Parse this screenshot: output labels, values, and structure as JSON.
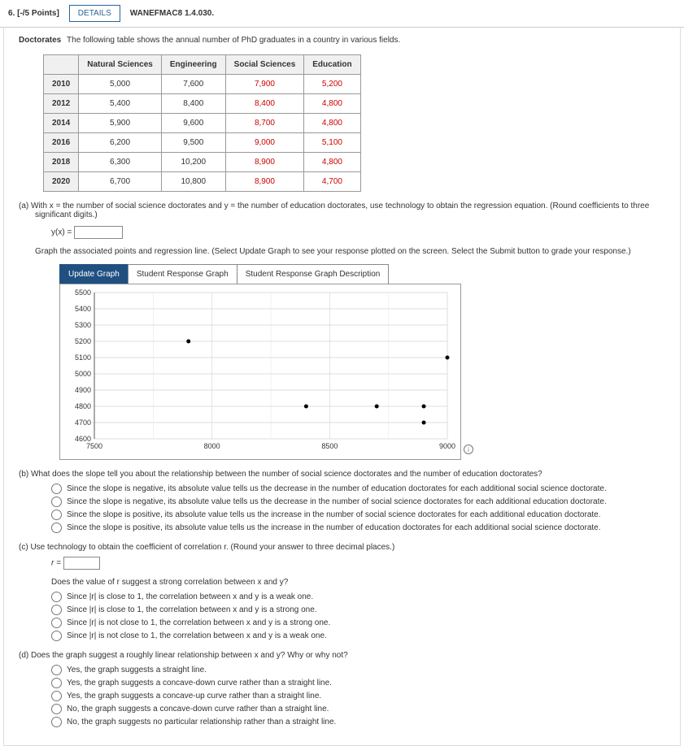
{
  "header": {
    "qnum": "6. [-/5 Points]",
    "details": "DETAILS",
    "book": "WANEFMAC8 1.4.030."
  },
  "intro": {
    "title": "Doctorates",
    "desc": "The following table shows the annual number of PhD graduates in a country in various fields."
  },
  "table": {
    "headers": [
      "",
      "Natural Sciences",
      "Engineering",
      "Social Sciences",
      "Education"
    ],
    "rows": [
      {
        "year": "2010",
        "cells": [
          "5,000",
          "7,600",
          "7,900",
          "5,200"
        ]
      },
      {
        "year": "2012",
        "cells": [
          "5,400",
          "8,400",
          "8,400",
          "4,800"
        ]
      },
      {
        "year": "2014",
        "cells": [
          "5,900",
          "9,600",
          "8,700",
          "4,800"
        ]
      },
      {
        "year": "2016",
        "cells": [
          "6,200",
          "9,500",
          "9,000",
          "5,100"
        ]
      },
      {
        "year": "2018",
        "cells": [
          "6,300",
          "10,200",
          "8,900",
          "4,800"
        ]
      },
      {
        "year": "2020",
        "cells": [
          "6,700",
          "10,800",
          "8,900",
          "4,700"
        ]
      }
    ]
  },
  "part_a": {
    "label": "(a)",
    "text": "With x = the number of social science doctorates and y = the number of education doctorates, use technology to obtain the regression equation. (Round coefficients to three significant digits.)",
    "yx": "y(x) = ",
    "graph_instr": "Graph the associated points and regression line. (Select Update Graph to see your response plotted on the screen. Select the Submit button to grade your response.)",
    "tabs": {
      "update": "Update Graph",
      "resp": "Student Response Graph",
      "desc": "Student Response Graph Description"
    }
  },
  "chart_data": {
    "type": "scatter",
    "x": [
      7900,
      8400,
      8700,
      9000,
      8900,
      8900
    ],
    "y": [
      5200,
      4800,
      4800,
      5100,
      4800,
      4700
    ],
    "xlim": [
      7500,
      9000
    ],
    "ylim": [
      4600,
      5500
    ],
    "x_ticks": [
      7500,
      8000,
      8500,
      9000
    ],
    "y_ticks": [
      4600,
      4700,
      4800,
      4900,
      5000,
      5100,
      5200,
      5300,
      5400,
      5500
    ]
  },
  "part_b": {
    "label": "(b)",
    "text": "What does the slope tell you about the relationship between the number of social science doctorates and the number of education doctorates?",
    "options": [
      "Since the slope is negative, its absolute value tells us the decrease in the number of education doctorates for each additional social science doctorate.",
      "Since the slope is negative, its absolute value tells us the decrease in the number of social science doctorates for each additional education doctorate.",
      "Since the slope is positive, its absolute value tells us the increase in the number of social science doctorates for each additional education doctorate.",
      "Since the slope is positive, its absolute value tells us the increase in the number of education doctorates for each additional social science doctorate."
    ]
  },
  "part_c": {
    "label": "(c)",
    "text": "Use technology to obtain the coefficient of correlation r. (Round your answer to three decimal places.)",
    "r_eq": "r = ",
    "subq": "Does the value of r suggest a strong correlation between x and y?",
    "options": [
      "Since |r| is close to 1, the correlation between x and y is a weak one.",
      "Since |r| is close to 1, the correlation between x and y is a strong one.",
      "Since |r| is not close to 1, the correlation between x and y is a strong one.",
      "Since |r| is not close to 1, the correlation between x and y is a weak one."
    ]
  },
  "part_d": {
    "label": "(d)",
    "text": "Does the graph suggest a roughly linear relationship between x and y? Why or why not?",
    "options": [
      "Yes, the graph suggests a straight line.",
      "Yes, the graph suggests a concave-down curve rather than a straight line.",
      "Yes, the graph suggests a concave-up curve rather than a straight line.",
      "No, the graph suggests a concave-down curve rather than a straight line.",
      "No, the graph suggests no particular relationship rather than a straight line."
    ]
  },
  "info_icon": "i"
}
